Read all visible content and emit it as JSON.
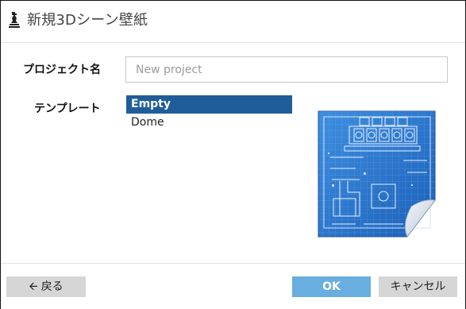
{
  "dialog": {
    "title": "新規3Dシーン壁紙",
    "title_icon": "game-piece-icon"
  },
  "form": {
    "project_label": "プロジェクト名",
    "project_value": "",
    "project_placeholder": "New project",
    "template_label": "テンプレート",
    "templates": [
      {
        "label": "Empty",
        "selected": true
      },
      {
        "label": "Dome",
        "selected": false
      }
    ],
    "preview_icon": "blueprint-icon"
  },
  "footer": {
    "back_label": "戻る",
    "back_icon": "arrow-left-icon",
    "ok_label": "OK",
    "cancel_label": "キャンセル"
  },
  "colors": {
    "selected_bg": "#1f5d99",
    "ok_bg": "#69aee0",
    "button_bg": "#d6d6d6"
  }
}
